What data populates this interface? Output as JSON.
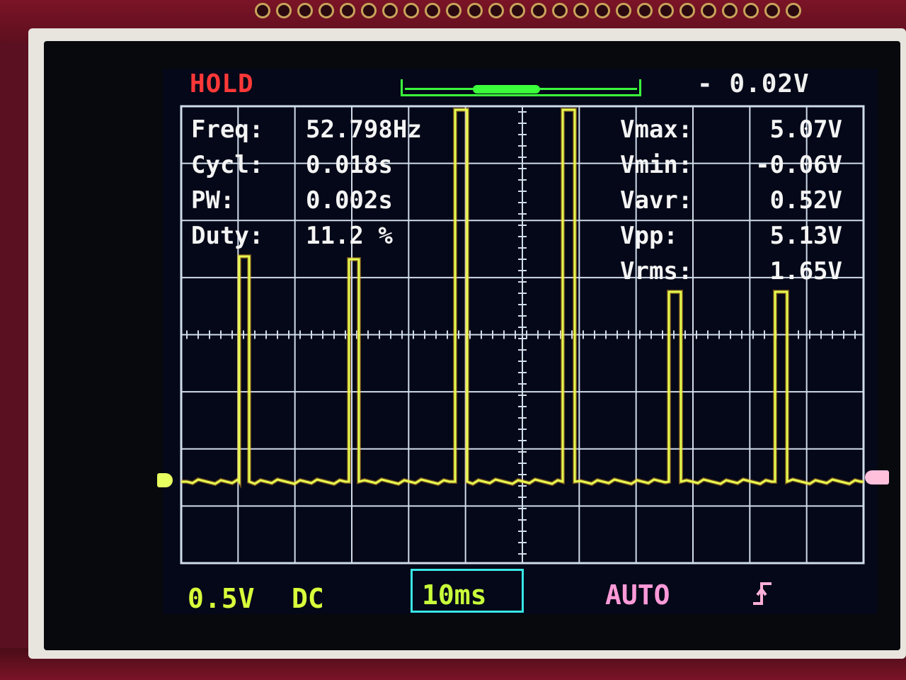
{
  "status": {
    "hold_label": "HOLD",
    "offset_label": "- 0.02V"
  },
  "measurements_left": [
    {
      "label": "Freq:",
      "value": "52.798Hz"
    },
    {
      "label": "Cycl:",
      "value": "0.018s"
    },
    {
      "label": "PW:",
      "value": "0.002s"
    },
    {
      "label": "Duty:",
      "value": "11.2 %"
    }
  ],
  "measurements_right": [
    {
      "label": "Vmax:",
      "value": "5.07V"
    },
    {
      "label": "Vmin:",
      "value": "-0.06V"
    },
    {
      "label": "Vavr:",
      "value": "0.52V"
    },
    {
      "label": "Vpp:",
      "value": "5.13V"
    },
    {
      "label": "Vrms:",
      "value": "1.65V"
    }
  ],
  "footer": {
    "volts_div": "0.5V",
    "coupling": "DC",
    "timebase": "10ms",
    "trigger_mode": "AUTO"
  },
  "icons": [
    "trigger-rising-edge-icon"
  ],
  "colors": {
    "hold": "#ff3838",
    "trace": "#e8ff50",
    "trace_edge": "#f0a020",
    "grid": "#d0dcea",
    "timebase_box": "#39e6e6",
    "trigger_mode": "#ff9ad8",
    "trigger_window": "#3cff3c"
  }
}
